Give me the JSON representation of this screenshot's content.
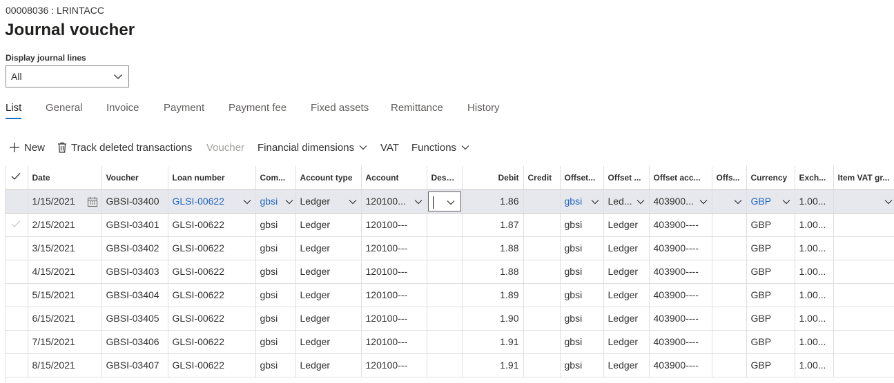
{
  "header": {
    "record_id": "00008036 : LRINTACC",
    "title": "Journal voucher"
  },
  "filter": {
    "label": "Display journal lines",
    "value": "All"
  },
  "tabs": [
    {
      "label": "List",
      "active": true
    },
    {
      "label": "General"
    },
    {
      "label": "Invoice"
    },
    {
      "label": "Payment"
    },
    {
      "label": "Payment fee"
    },
    {
      "label": "Fixed assets"
    },
    {
      "label": "Remittance"
    },
    {
      "label": "History"
    }
  ],
  "toolbar": {
    "new": "New",
    "track_deleted": "Track deleted transactions",
    "voucher": "Voucher",
    "financial_dimensions": "Financial dimensions",
    "vat": "VAT",
    "functions": "Functions"
  },
  "grid": {
    "columns": [
      "Date",
      "Voucher",
      "Loan number",
      "Com...",
      "Account type",
      "Account",
      "Desc...",
      "Debit",
      "Credit",
      "Offset...",
      "Offset ...",
      "Offset acc...",
      "Offs...",
      "Currency",
      "Exch...",
      "Item VAT gr..."
    ],
    "rows": [
      {
        "date": "1/15/2021",
        "voucher": "GBSI-03400",
        "loan": "GLSI-00622",
        "company": "gbsi",
        "account_type": "Ledger",
        "account": "120100...",
        "description": "",
        "debit": "1.86",
        "credit": "",
        "offset_company": "gbsi",
        "offset_type": "Led...",
        "offset_account": "403900...",
        "offset_other": "",
        "currency": "GBP",
        "exchange": "1.00...",
        "item_vat": ""
      },
      {
        "date": "2/15/2021",
        "voucher": "GBSI-03401",
        "loan": "GLSI-00622",
        "company": "gbsi",
        "account_type": "Ledger",
        "account": "120100---",
        "description": "",
        "debit": "1.87",
        "credit": "",
        "offset_company": "gbsi",
        "offset_type": "Ledger",
        "offset_account": "403900----",
        "offset_other": "",
        "currency": "GBP",
        "exchange": "1.00...",
        "item_vat": ""
      },
      {
        "date": "3/15/2021",
        "voucher": "GBSI-03402",
        "loan": "GLSI-00622",
        "company": "gbsi",
        "account_type": "Ledger",
        "account": "120100---",
        "description": "",
        "debit": "1.88",
        "credit": "",
        "offset_company": "gbsi",
        "offset_type": "Ledger",
        "offset_account": "403900----",
        "offset_other": "",
        "currency": "GBP",
        "exchange": "1.00...",
        "item_vat": ""
      },
      {
        "date": "4/15/2021",
        "voucher": "GBSI-03403",
        "loan": "GLSI-00622",
        "company": "gbsi",
        "account_type": "Ledger",
        "account": "120100---",
        "description": "",
        "debit": "1.88",
        "credit": "",
        "offset_company": "gbsi",
        "offset_type": "Ledger",
        "offset_account": "403900----",
        "offset_other": "",
        "currency": "GBP",
        "exchange": "1.00...",
        "item_vat": ""
      },
      {
        "date": "5/15/2021",
        "voucher": "GBSI-03404",
        "loan": "GLSI-00622",
        "company": "gbsi",
        "account_type": "Ledger",
        "account": "120100---",
        "description": "",
        "debit": "1.89",
        "credit": "",
        "offset_company": "gbsi",
        "offset_type": "Ledger",
        "offset_account": "403900----",
        "offset_other": "",
        "currency": "GBP",
        "exchange": "1.00...",
        "item_vat": ""
      },
      {
        "date": "6/15/2021",
        "voucher": "GBSI-03405",
        "loan": "GLSI-00622",
        "company": "gbsi",
        "account_type": "Ledger",
        "account": "120100---",
        "description": "",
        "debit": "1.90",
        "credit": "",
        "offset_company": "gbsi",
        "offset_type": "Ledger",
        "offset_account": "403900----",
        "offset_other": "",
        "currency": "GBP",
        "exchange": "1.00...",
        "item_vat": ""
      },
      {
        "date": "7/15/2021",
        "voucher": "GBSI-03406",
        "loan": "GLSI-00622",
        "company": "gbsi",
        "account_type": "Ledger",
        "account": "120100---",
        "description": "",
        "debit": "1.91",
        "credit": "",
        "offset_company": "gbsi",
        "offset_type": "Ledger",
        "offset_account": "403900----",
        "offset_other": "",
        "currency": "GBP",
        "exchange": "1.00...",
        "item_vat": ""
      },
      {
        "date": "8/15/2021",
        "voucher": "GBSI-03407",
        "loan": "GLSI-00622",
        "company": "gbsi",
        "account_type": "Ledger",
        "account": "120100---",
        "description": "",
        "debit": "1.91",
        "credit": "",
        "offset_company": "gbsi",
        "offset_type": "Ledger",
        "offset_account": "403900----",
        "offset_other": "",
        "currency": "GBP",
        "exchange": "1.00...",
        "item_vat": ""
      }
    ]
  },
  "colors": {
    "accent": "#0f6cbd",
    "link": "#2266c0",
    "selected_row": "#e6e8ee"
  }
}
